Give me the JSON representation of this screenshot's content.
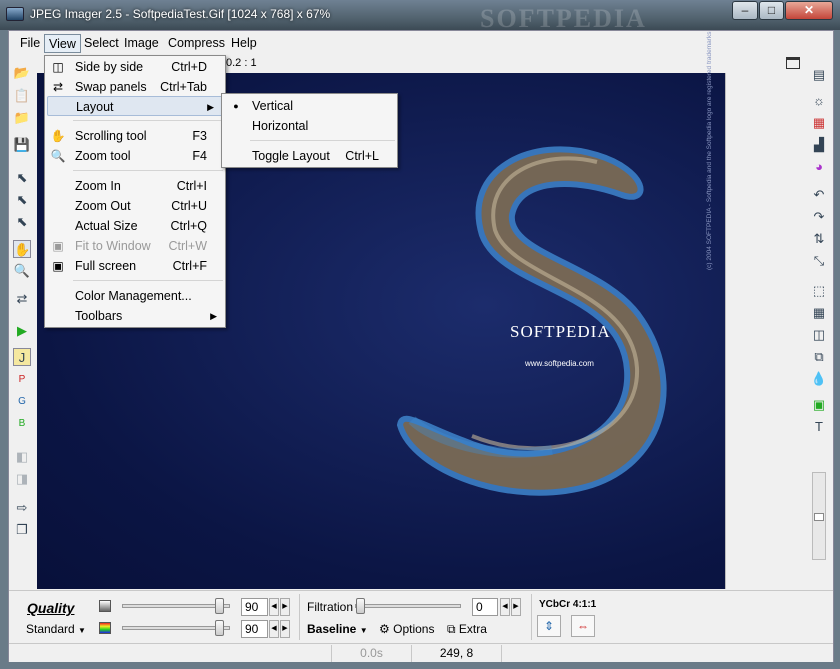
{
  "window": {
    "title": "JPEG Imager 2.5 - SoftpediaTest.Gif [1024 x 768] x 67%",
    "background_watermark": "SOFTPEDIA",
    "buttons": {
      "minimize": "–",
      "maximize": "□",
      "close": "✕"
    }
  },
  "menubar": {
    "items": [
      "File",
      "View",
      "Select",
      "Image",
      "Compress",
      "Help"
    ],
    "active": "View"
  },
  "pane": {
    "zoom_label": "0.2 : 1"
  },
  "view_menu": {
    "items": [
      {
        "label": "Side by side",
        "shortcut": "Ctrl+D",
        "icon": "side-by-side-icon"
      },
      {
        "label": "Swap panels",
        "shortcut": "Ctrl+Tab",
        "icon": "swap-panels-icon"
      },
      {
        "label": "Layout",
        "shortcut": "",
        "submenu": true
      },
      {
        "label": "Scrolling tool",
        "shortcut": "F3",
        "icon": "hand-icon"
      },
      {
        "label": "Zoom tool",
        "shortcut": "F4",
        "icon": "magnifier-icon"
      },
      {
        "label": "Zoom In",
        "shortcut": "Ctrl+I"
      },
      {
        "label": "Zoom Out",
        "shortcut": "Ctrl+U"
      },
      {
        "label": "Actual Size",
        "shortcut": "Ctrl+Q"
      },
      {
        "label": "Fit to Window",
        "shortcut": "Ctrl+W",
        "disabled": true,
        "icon": "fit-window-icon"
      },
      {
        "label": "Full screen",
        "shortcut": "Ctrl+F",
        "icon": "fullscreen-icon"
      },
      {
        "label": "Color Management...",
        "shortcut": ""
      },
      {
        "label": "Toolbars",
        "shortcut": "",
        "submenu": true
      }
    ]
  },
  "layout_menu": {
    "items": [
      {
        "label": "Vertical",
        "shortcut": "",
        "checked": true
      },
      {
        "label": "Horizontal",
        "shortcut": ""
      },
      {
        "label": "Toggle Layout",
        "shortcut": "Ctrl+L"
      }
    ]
  },
  "image": {
    "logo_text": "SOFTPEDIA",
    "url_text": "www.softpedia.com",
    "copyright_text": "(c) 2004 SOFTPEDIA - Softpedia and the Softpedia logo are registered trademarks"
  },
  "bottom": {
    "quality_label": "Quality",
    "preset": "Standard",
    "quality_value_1": "90",
    "quality_value_2": "90",
    "quality_slider_level": 0.95,
    "filtration_label": "Filtration",
    "filtration_value": "0",
    "filtration_slider_level": 0.0,
    "baseline_label": "Baseline",
    "options_label": "Options",
    "extra_label": "Extra",
    "ycbcr_label": "YCbCr 4:1:1"
  },
  "status": {
    "time": "0.0s",
    "coords": "249, 8"
  },
  "colors": {
    "accent_menu_highlight": "#dfe7f1",
    "image_background": "#0b1544"
  }
}
